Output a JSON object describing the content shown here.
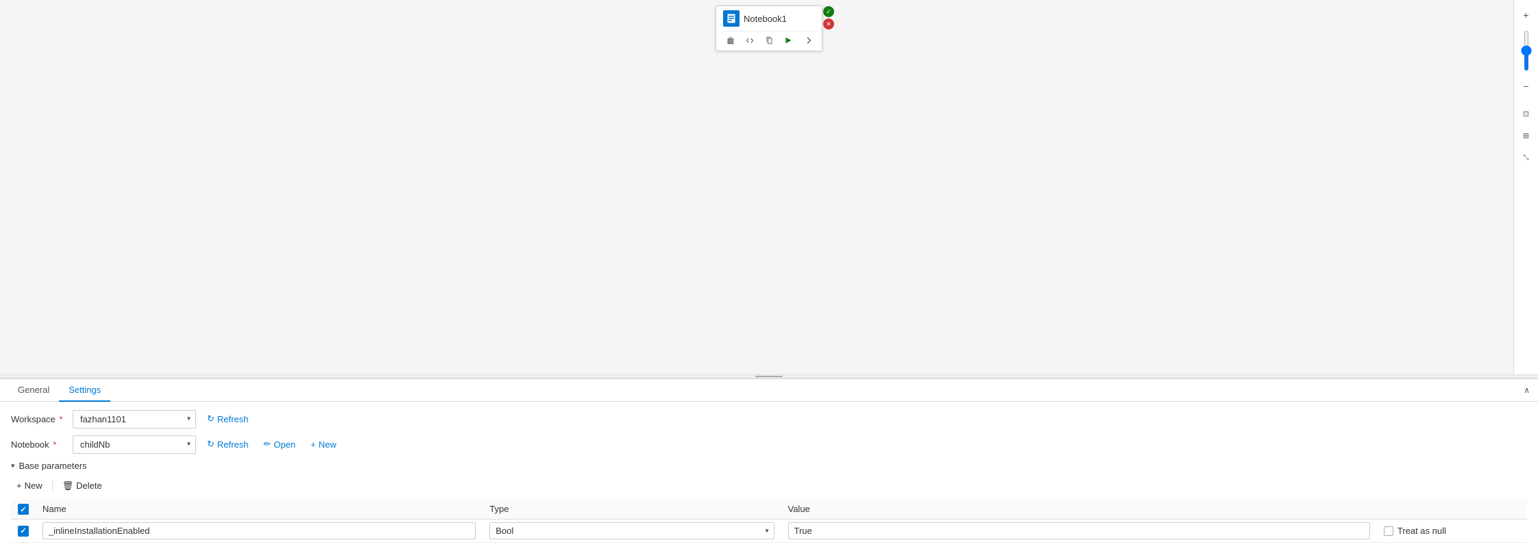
{
  "canvas": {
    "notebook_node": {
      "title": "Notebook1",
      "icon_label": "NB"
    }
  },
  "right_toolbar": {
    "buttons": [
      {
        "name": "plus-icon",
        "symbol": "+"
      },
      {
        "name": "minus-icon",
        "symbol": "−"
      },
      {
        "name": "fit-page-icon",
        "symbol": "⊡"
      },
      {
        "name": "fit-width-icon",
        "symbol": "⊞"
      },
      {
        "name": "collapse-icon",
        "symbol": "⤡"
      }
    ]
  },
  "tabs": [
    {
      "label": "General",
      "active": false
    },
    {
      "label": "Settings",
      "active": true
    }
  ],
  "settings": {
    "workspace_label": "Workspace",
    "workspace_required": true,
    "workspace_value": "fazhan1101",
    "workspace_refresh_label": "Refresh",
    "notebook_label": "Notebook",
    "notebook_required": true,
    "notebook_value": "childNb",
    "notebook_refresh_label": "Refresh",
    "notebook_open_label": "Open",
    "notebook_new_label": "New",
    "base_params_label": "Base parameters",
    "new_button_label": "New",
    "delete_button_label": "Delete",
    "table": {
      "columns": [
        "Name",
        "Type",
        "Value"
      ],
      "rows": [
        {
          "checked": true,
          "name": "_inlineInstallationEnabled",
          "type": "Bool",
          "value": "True",
          "treat_as_null": false
        }
      ]
    },
    "treat_null_label": "Treat as null"
  },
  "collapse_btn_label": "∧"
}
